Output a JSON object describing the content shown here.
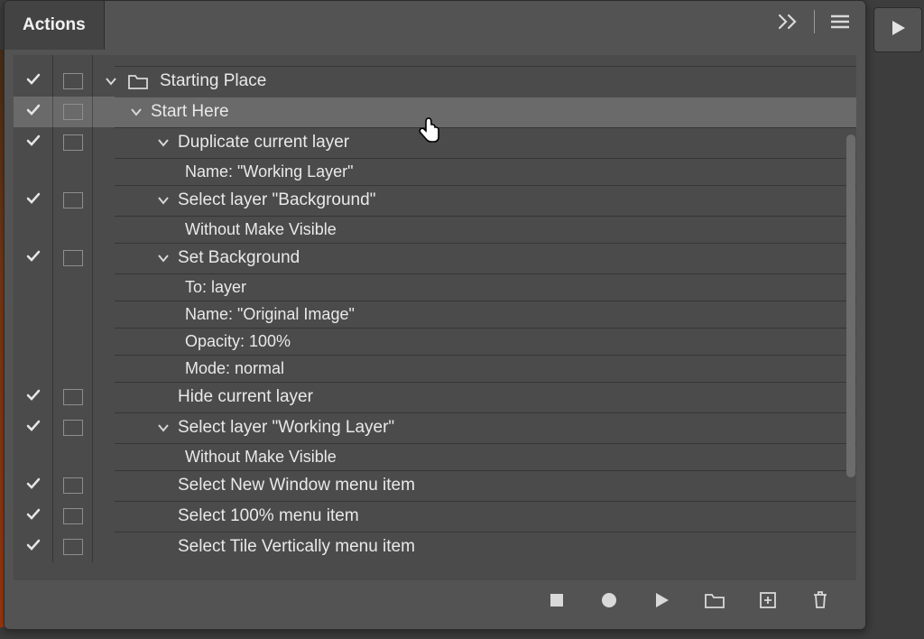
{
  "panel": {
    "title": "Actions"
  },
  "set": {
    "name": "Starting Place"
  },
  "action": {
    "name": "Start Here"
  },
  "steps": {
    "dupLayer": {
      "label": "Duplicate current layer",
      "detail1": "Name:  \"Working Layer\""
    },
    "selBg": {
      "label": "Select layer \"Background\"",
      "detail1": "Without Make Visible"
    },
    "setBg": {
      "label": "Set Background",
      "d1": "To: layer",
      "d2": "Name:  \"Original Image\"",
      "d3": "Opacity: 100%",
      "d4": "Mode: normal"
    },
    "hide": {
      "label": "Hide current layer"
    },
    "selWork": {
      "label": "Select layer \"Working Layer\"",
      "detail1": "Without Make Visible"
    },
    "newWin": {
      "label": "Select New Window menu item"
    },
    "sel100": {
      "label": "Select 100% menu item"
    },
    "tileV": {
      "label": "Select Tile Vertically menu item"
    }
  }
}
